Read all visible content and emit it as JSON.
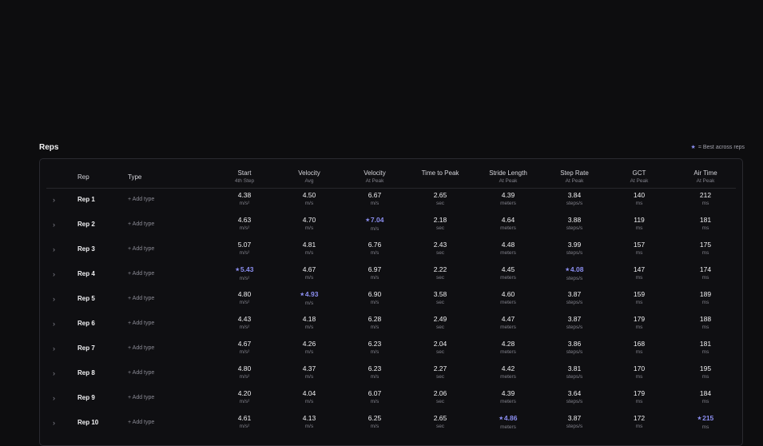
{
  "section_title": "Reps",
  "legend": {
    "star_icon": "star-icon",
    "text": "= Best across reps",
    "accent": "#8b8ef0"
  },
  "columns": [
    {
      "key": "start",
      "title": "Start",
      "sub": "4th Step"
    },
    {
      "key": "vel_avg",
      "title": "Velocity",
      "sub": "Avg"
    },
    {
      "key": "vel_peak",
      "title": "Velocity",
      "sub": "At Peak"
    },
    {
      "key": "ttp",
      "title": "Time to Peak",
      "sub": ""
    },
    {
      "key": "stride",
      "title": "Stride Length",
      "sub": "At Peak"
    },
    {
      "key": "step_rate",
      "title": "Step Rate",
      "sub": "At Peak"
    },
    {
      "key": "gct",
      "title": "GCT",
      "sub": "At Peak"
    },
    {
      "key": "air",
      "title": "Air Time",
      "sub": "At Peak"
    }
  ],
  "header": {
    "rep": "Rep",
    "type": "Type"
  },
  "units": [
    "m/s²",
    "m/s",
    "m/s",
    "sec",
    "meters",
    "steps/s",
    "ms",
    "ms"
  ],
  "add_type_label": "+ Add type",
  "rows": [
    {
      "rep": "Rep 1",
      "values": [
        "4.38",
        "4.50",
        "6.67",
        "2.65",
        "4.39",
        "3.84",
        "140",
        "212"
      ],
      "best": []
    },
    {
      "rep": "Rep 2",
      "values": [
        "4.63",
        "4.70",
        "7.04",
        "2.18",
        "4.64",
        "3.88",
        "119",
        "181"
      ],
      "best": [
        2
      ]
    },
    {
      "rep": "Rep 3",
      "values": [
        "5.07",
        "4.81",
        "6.76",
        "2.43",
        "4.48",
        "3.99",
        "157",
        "175"
      ],
      "best": []
    },
    {
      "rep": "Rep 4",
      "values": [
        "5.43",
        "4.67",
        "6.97",
        "2.22",
        "4.45",
        "4.08",
        "147",
        "174"
      ],
      "best": [
        0,
        5
      ]
    },
    {
      "rep": "Rep 5",
      "values": [
        "4.80",
        "4.93",
        "6.90",
        "3.58",
        "4.60",
        "3.87",
        "159",
        "189"
      ],
      "best": [
        1
      ]
    },
    {
      "rep": "Rep 6",
      "values": [
        "4.43",
        "4.18",
        "6.28",
        "2.49",
        "4.47",
        "3.87",
        "179",
        "188"
      ],
      "best": []
    },
    {
      "rep": "Rep 7",
      "values": [
        "4.67",
        "4.26",
        "6.23",
        "2.04",
        "4.28",
        "3.86",
        "168",
        "181"
      ],
      "best": []
    },
    {
      "rep": "Rep 8",
      "values": [
        "4.80",
        "4.37",
        "6.23",
        "2.27",
        "4.42",
        "3.81",
        "170",
        "195"
      ],
      "best": []
    },
    {
      "rep": "Rep 9",
      "values": [
        "4.20",
        "4.04",
        "6.07",
        "2.06",
        "4.39",
        "3.64",
        "179",
        "184"
      ],
      "best": []
    },
    {
      "rep": "Rep 10",
      "values": [
        "4.61",
        "4.13",
        "6.25",
        "2.65",
        "4.86",
        "3.87",
        "172",
        "215"
      ],
      "best": [
        4,
        7
      ]
    }
  ]
}
